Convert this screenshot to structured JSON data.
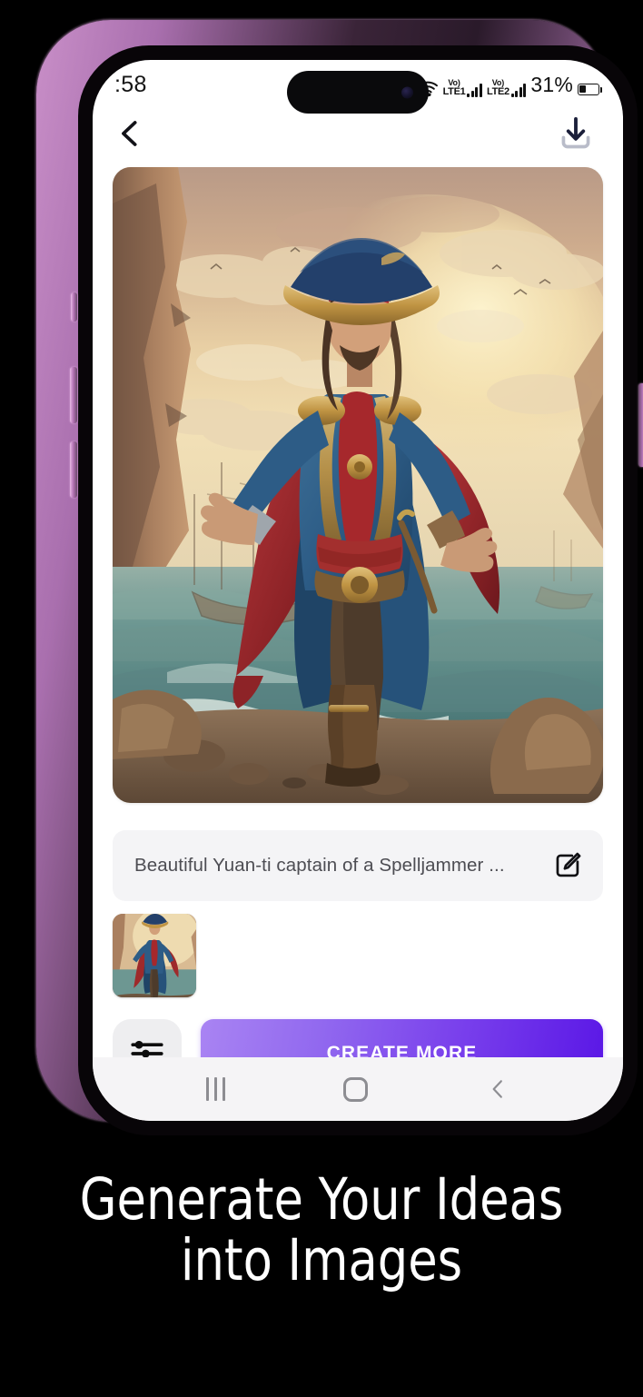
{
  "status_bar": {
    "time": ":58",
    "wifi_icon": "wifi-icon",
    "sim1_volte_top": "Vo)",
    "sim1_volte_bottom": "LTE1",
    "sim2_volte_top": "Vo)",
    "sim2_volte_bottom": "LTE2",
    "battery_percent": "31%",
    "battery_level": 31
  },
  "app_bar": {
    "back_icon": "back-chevron-icon",
    "download_icon": "download-icon"
  },
  "artwork": {
    "alt": "Fantasy pirate captain in blue and red coat standing on rocky shore at sunset",
    "colors": {
      "sky_top": "#c9a68c",
      "sky_glow": "#f5e2b4",
      "sea": "#6f9a96",
      "coat_blue": "#2f5d87",
      "cape_red": "#9e2a2b",
      "gold": "#c8963c",
      "rock": "#8a6a4c"
    }
  },
  "prompt": {
    "text": "Beautiful Yuan-ti captain of a Spelljammer ...",
    "edit_icon": "edit-pencil-icon"
  },
  "thumbnails": [
    {
      "alt": "Generated pirate captain thumbnail"
    }
  ],
  "actions": {
    "settings_icon": "sliders-settings-icon",
    "create_more_label": "CREATE MORE",
    "gradient_start": "#a984f3",
    "gradient_end": "#5a17e6"
  },
  "nav_bar": {
    "recents_icon": "recents-icon",
    "home_icon": "home-icon",
    "back_icon": "nav-back-icon"
  },
  "caption": {
    "line1": "Generate Your  Ideas",
    "line2": "into  Images"
  },
  "device": {
    "frame_color": "#c98fc8"
  }
}
